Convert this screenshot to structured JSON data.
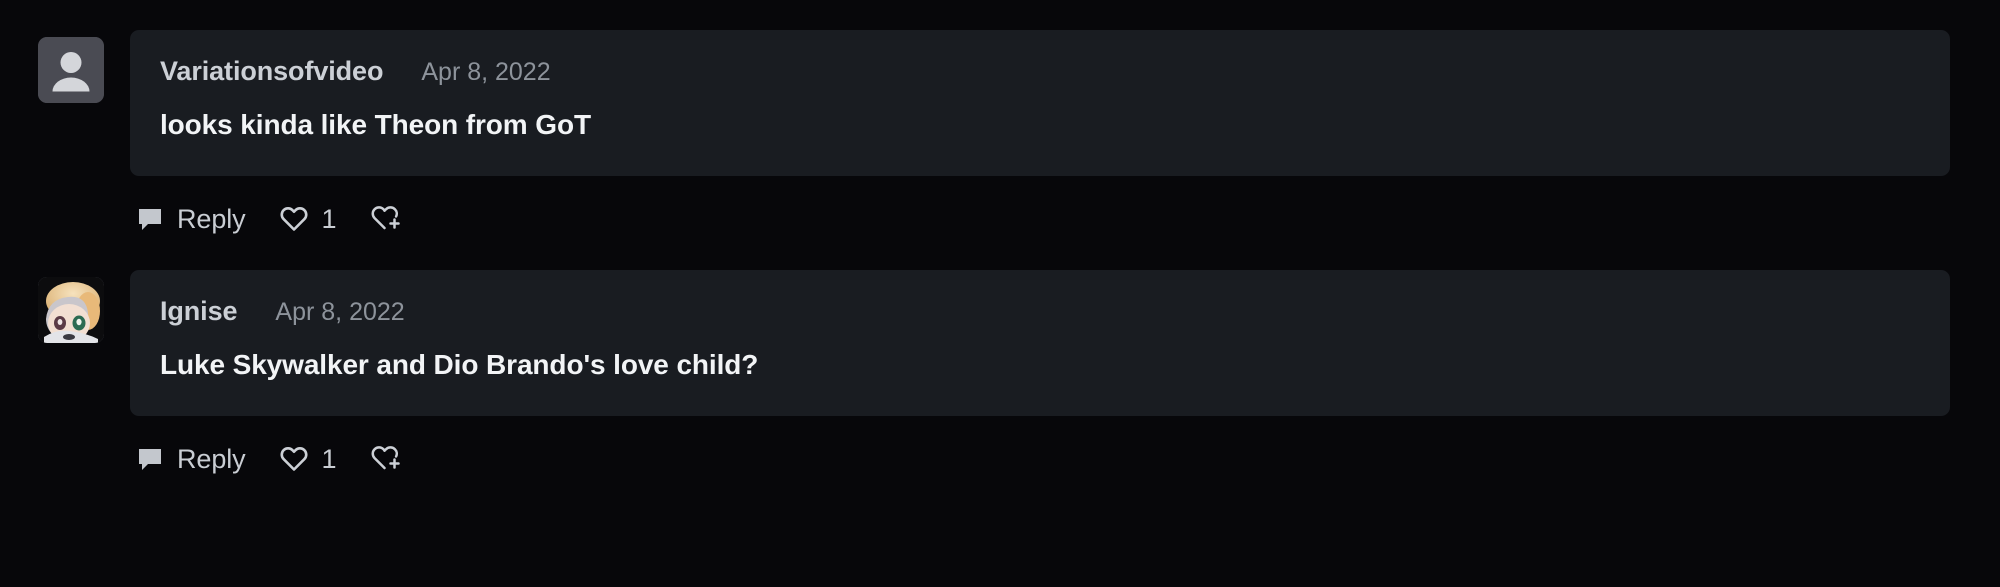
{
  "page": {
    "background_color": "#07070a",
    "comment_background_color": "#191c21",
    "text_color": "#f2f4f6",
    "muted_text_color": "#8d939b",
    "author_color": "#ccd0d6",
    "icon_color": "#c9cdd3"
  },
  "comments": [
    {
      "author": "Variationsofvideo",
      "timestamp": "Apr 8, 2022",
      "text": "looks kinda like Theon from GoT",
      "avatar_type": "default-placeholder-avatar",
      "actions": {
        "reply_label": "Reply",
        "reply_icon": "speech-bubble-icon",
        "like_icon": "heart-outline-icon",
        "like_count": "1",
        "award_icon": "heart-plus-icon"
      }
    },
    {
      "author": "Ignise",
      "timestamp": "Apr 8, 2022",
      "text": "Luke Skywalker and Dio Brando's love child?",
      "avatar_type": "user-photo-avatar",
      "actions": {
        "reply_label": "Reply",
        "reply_icon": "speech-bubble-icon",
        "like_icon": "heart-outline-icon",
        "like_count": "1",
        "award_icon": "heart-plus-icon"
      }
    }
  ]
}
